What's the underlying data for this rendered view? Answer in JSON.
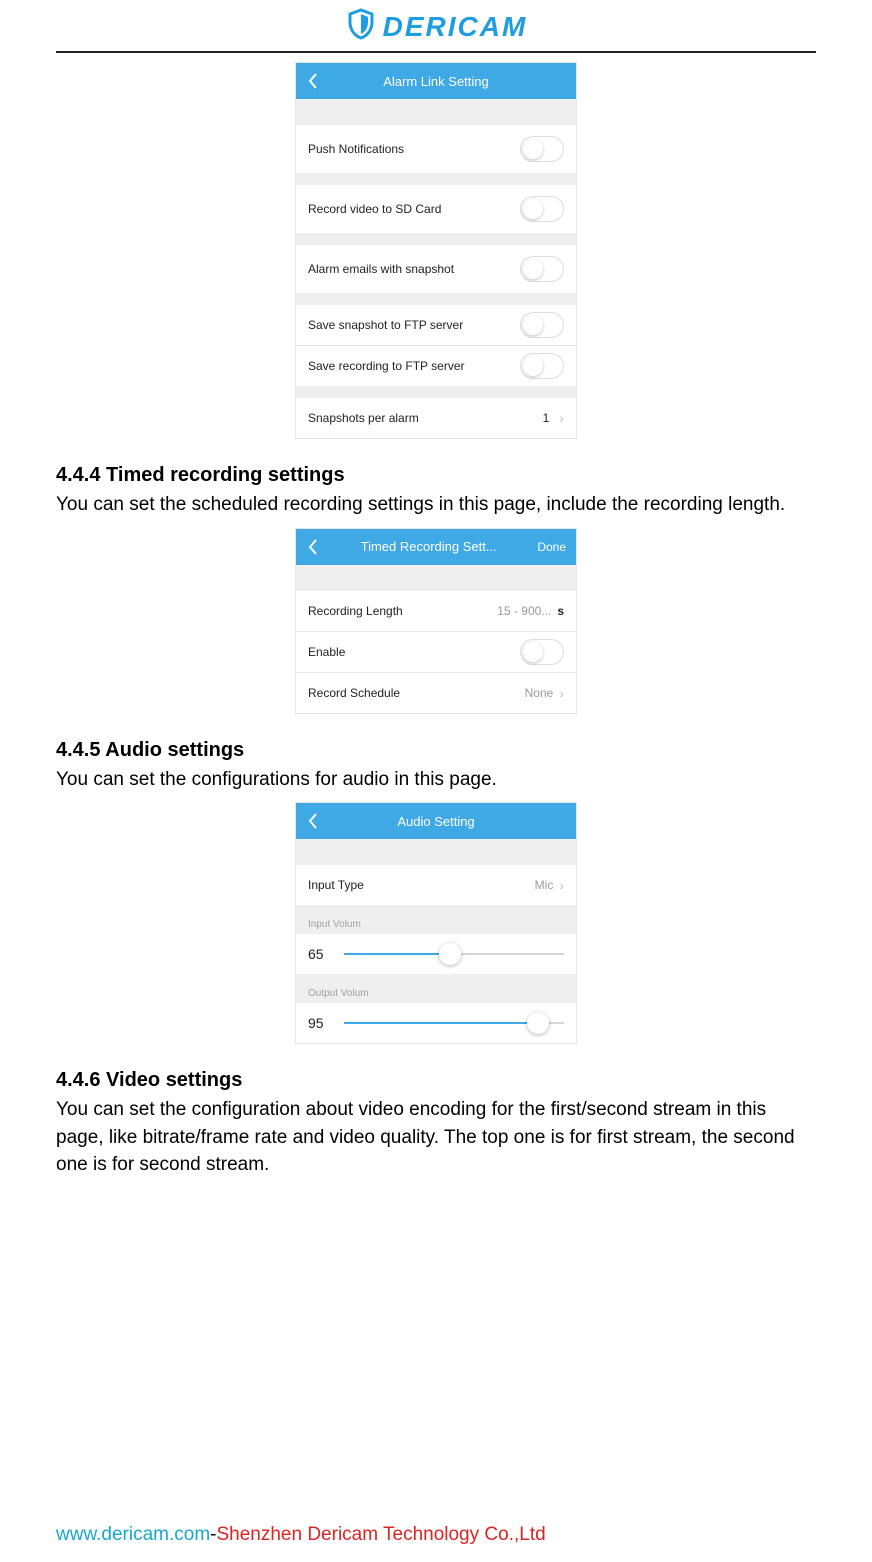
{
  "logo_text": "DERICAM",
  "sections": {
    "alarm_link": {
      "title": "Alarm Link Setting",
      "rows": {
        "push_notifications": "Push Notifications",
        "record_sd": "Record video to SD Card",
        "alarm_emails": "Alarm emails with snapshot",
        "save_snapshot_ftp": "Save snapshot to FTP server",
        "save_recording_ftp": "Save recording to FTP server",
        "snapshots_per_alarm": "Snapshots per alarm",
        "snapshots_value": "1"
      }
    },
    "timed_recording_heading": "4.4.4 Timed recording settings",
    "timed_recording_desc": "You can set the scheduled recording settings in this page, include the recording length.",
    "timed_recording": {
      "title": "Timed Recording Sett...",
      "done": "Done",
      "rows": {
        "recording_length": "Recording Length",
        "recording_length_value": "15 - 900...",
        "recording_length_unit": "s",
        "enable": "Enable",
        "record_schedule": "Record Schedule",
        "record_schedule_value": "None"
      }
    },
    "audio_heading": "4.4.5 Audio settings",
    "audio_desc": "You can set the configurations for audio in this page.",
    "audio": {
      "title": "Audio Setting",
      "rows": {
        "input_type": "Input Type",
        "input_type_value": "Mic",
        "input_volume_label": "Input Volum",
        "input_volume_value": "65",
        "output_volume_label": "Output Volum",
        "output_volume_value": "95"
      }
    },
    "video_heading": "4.4.6 Video settings",
    "video_desc": "You can set the configuration about video encoding for the first/second stream in this page, like bitrate/frame rate and video quality. The top one is for first stream, the second one is for second stream."
  },
  "footer": {
    "url": "www.dericam.com",
    "dash": "-",
    "company": "Shenzhen Dericam Technology Co.,Ltd"
  }
}
